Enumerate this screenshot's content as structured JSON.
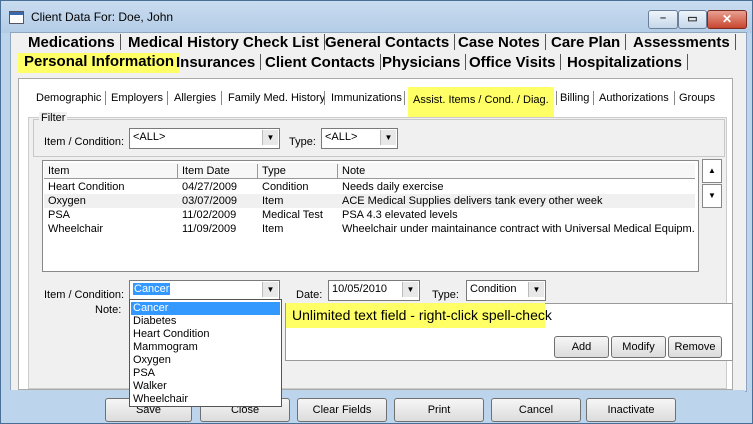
{
  "window": {
    "title": "Client Data For: Doe, John"
  },
  "main_tabs_row1": [
    "Medications",
    "Medical History Check List",
    "General Contacts",
    "Case Notes",
    "Care Plan",
    "Assessments"
  ],
  "main_tabs_row2": [
    "Personal Information",
    "Insurances",
    "Client Contacts",
    "Physicians",
    "Office Visits",
    "Hospitalizations"
  ],
  "active_main_tab": "Personal Information",
  "sub_tabs": [
    "Demographic",
    "Employers",
    "Allergies",
    "Family Med. History",
    "Immunizations",
    "Assist. Items / Cond. / Diag.",
    "Billing",
    "Authorizations",
    "Groups"
  ],
  "active_sub_tab": "Assist. Items / Cond. / Diag.",
  "filter": {
    "legend": "Filter",
    "item_label": "Item / Condition:",
    "item_value": "<ALL>",
    "type_label": "Type:",
    "type_value": "<ALL>"
  },
  "table": {
    "columns": [
      "Item",
      "Item Date",
      "Type",
      "Note"
    ],
    "rows": [
      [
        "Heart Condition",
        "04/27/2009",
        "Condition",
        "Needs daily exercise"
      ],
      [
        "Oxygen",
        "03/07/2009",
        "Item",
        "ACE Medical Supplies delivers tank every other week"
      ],
      [
        "PSA",
        "11/02/2009",
        "Medical Test",
        "PSA 4.3 elevated levels"
      ],
      [
        "Wheelchair",
        "11/09/2009",
        "Item",
        "Wheelchair under maintainance contract with Universal Medical Equipm..."
      ]
    ]
  },
  "editor": {
    "item_label": "Item / Condition:",
    "item_value": "Cancer",
    "date_label": "Date:",
    "date_value": "10/05/2010",
    "type_label": "Type:",
    "type_value": "Condition",
    "note_label": "Note:",
    "dropdown_options": [
      "Cancer",
      "Diabetes",
      "Heart Condition",
      "Mammogram",
      "Oxygen",
      "PSA",
      "Walker",
      "Wheelchair"
    ],
    "selected_option": "Cancer"
  },
  "callout": "Unlimited text field - right-click spell-check",
  "row_buttons": {
    "add": "Add",
    "modify": "Modify",
    "remove": "Remove"
  },
  "bottom_buttons": {
    "save": "Save",
    "close": "Close",
    "clear_fields": "Clear Fields",
    "print": "Print",
    "cancel": "Cancel",
    "inactivate": "Inactivate"
  },
  "colors": {
    "highlight": "#ffff66",
    "selection": "#3399ff",
    "window_frame": "#bcd4ec"
  }
}
